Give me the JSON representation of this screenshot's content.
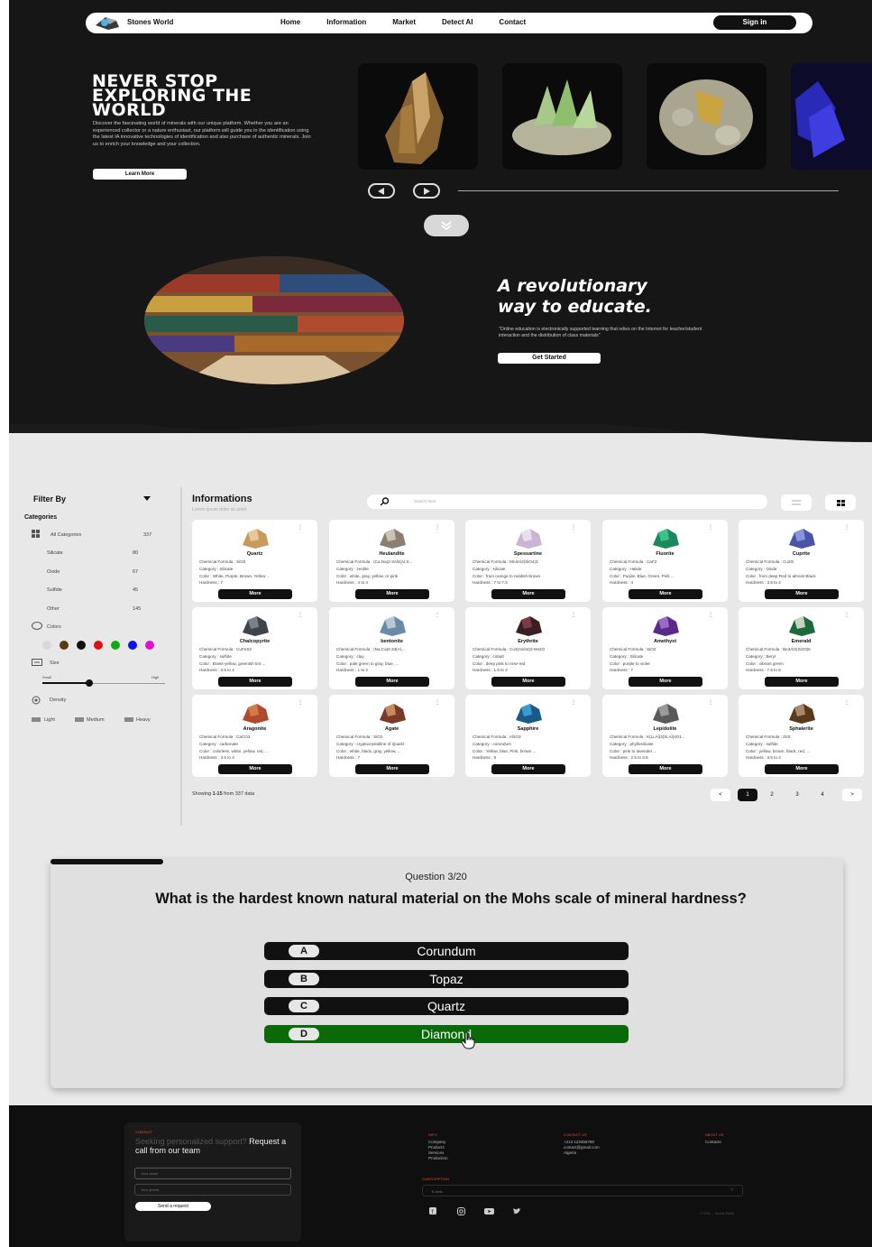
{
  "nav": {
    "brand": "Stones World",
    "items": [
      "Home",
      "Information",
      "Market",
      "Detect AI",
      "Contact"
    ],
    "signin": "Sign in"
  },
  "hero": {
    "title": "NEVER STOP EXPLORING THE WORLD",
    "intro": "Discover the fascinating world of minerals with our unique platform. Whether you are an experienced collector or a nature enthusiast, our platform will guide you in the identification using the latest IA innovative technologies of identification and also purchase of authentic minerals. Join us to enrich your knowledge and your collection.",
    "learn_more": "Learn More"
  },
  "revolution": {
    "title_line1": "A revolutionary",
    "title_line2": "way to educate.",
    "quote": "\"Online education is electronically supported learning that relies on the Internet for teacher/student interaction and the distribution of class materials\"",
    "cta": "Get Started"
  },
  "filters": {
    "title": "Filter By",
    "categories_title": "Categories",
    "categories": [
      {
        "label": "All Categories",
        "count": "337"
      },
      {
        "label": "Silicate",
        "count": "80"
      },
      {
        "label": "Oxide",
        "count": "67"
      },
      {
        "label": "Sulfide",
        "count": "45"
      },
      {
        "label": "Other",
        "count": "145"
      }
    ],
    "colors_title": "Colors",
    "colors": [
      "#d9d9d9",
      "#5a3a12",
      "#111111",
      "#dd1111",
      "#11aa11",
      "#1111ee",
      "#dd11cc"
    ],
    "size_title": "Size",
    "size_low": "Small",
    "size_high": "High",
    "size_level": 0.5,
    "density_title": "Density",
    "density_options": [
      "Light",
      "Medium",
      "Heavy"
    ]
  },
  "info": {
    "title": "Informations",
    "subtitle": "Lorem ipsum dolor sit amet",
    "search_placeholder": "Search here",
    "more_label": "More",
    "cards": [
      {
        "name": "Quartz",
        "formula": "Chemical Formula : SiO2",
        "category": "Category : Silicate",
        "color": "Color : White, Purple, Brown, Yellow ...",
        "hardness": "Hardness : 7"
      },
      {
        "name": "Heulandite",
        "formula": "Chemical Formula : (Ca,Na)2-3Al3(Al,S...",
        "category": "Category : zeolite",
        "color": "Color : white, gray, yellow, or pink",
        "hardness": "Hardness : 4 to 4"
      },
      {
        "name": "Spessartine",
        "formula": "Chemical Formula : Mn3Al2(SiO4)3",
        "category": "Category : silicate",
        "color": "Color : from orange to reddish-brown",
        "hardness": "Hardness : 7 to 7.5"
      },
      {
        "name": "Fluorite",
        "formula": "Chemical Formula : CaF2",
        "category": "Category : Halide",
        "color": "Color : Purple, Blue, Green, Pink ...",
        "hardness": "Hardness : 4"
      },
      {
        "name": "Cuprite",
        "formula": "Chemical Formula : Cu2O",
        "category": "Category : Oxide",
        "color": "Color : from deep Red to almost Black",
        "hardness": "Hardness : 3.5 to 4"
      },
      {
        "name": "Chalcopyrite",
        "formula": "Chemical Formula : CuFeS2",
        "category": "Category : sulfide",
        "color": "Color : Brass-yellow, greenish tint ...",
        "hardness": "Hardness : 3.5 to 4"
      },
      {
        "name": "bentonite",
        "formula": "Chemical Formula : (Na,Ca)0.33(Al,...",
        "category": "Category : clay",
        "color": "Color : pale green to gray, blue, ...",
        "hardness": "Hardness : 1 to 2"
      },
      {
        "name": "Erythrite",
        "formula": "Chemical Formula : Co3(AsO4)2·8H2O",
        "category": "Category : cobalt",
        "color": "Color : deep pink to rose-red",
        "hardness": "Hardness : 1.5 to 2"
      },
      {
        "name": "Amethyst",
        "formula": "Chemical Formula : SiO2",
        "category": "Category : Silicate",
        "color": "Color : purple to violet",
        "hardness": "Hardness : 7"
      },
      {
        "name": "Emerald",
        "formula": "Chemical Formula : Be3Al2(SiO3)6",
        "category": "Category : Beryl",
        "color": "Color : vibrant green",
        "hardness": "Hardness : 7.5 to 8"
      },
      {
        "name": "Aragonite",
        "formula": "Chemical Formula : CaCO3",
        "category": "Category : carbonate",
        "color": "Color : colorless, white, yellow, red, ...",
        "hardness": "Hardness : 3.5 to 4"
      },
      {
        "name": "Agate",
        "formula": "Chemical Formula : SiO2",
        "category": "Category : cryptocrystalline of Quartz",
        "color": "Color : white, black, gray, yellow, ...",
        "hardness": "Hardness : 7"
      },
      {
        "name": "Sapphire",
        "formula": "Chemical Formula : Al2O3",
        "category": "Category : corundum",
        "color": "Color : Yellow, blue, Pink, brown ...",
        "hardness": "Hardness : 9"
      },
      {
        "name": "Lepidolite",
        "formula": "Chemical Formula : K(Li,Al)3(Si,Al)4O1...",
        "category": "Category : phyllosilicate",
        "color": "Color : pink to lavender ...",
        "hardness": "Hardness : 2.5 to 3.5"
      },
      {
        "name": "Sphalerite",
        "formula": "Chemical Formula : ZnS",
        "category": "Category : sulfide",
        "color": "Color : yellow, brown, black, red, ...",
        "hardness": "Hardness : 3.5 to 4"
      }
    ],
    "showing_prefix": "Showing ",
    "showing_range": "1-15",
    "showing_suffix": " from 337 data",
    "pages": [
      "1",
      "2",
      "3",
      "4"
    ],
    "prev": "<",
    "next": ">"
  },
  "quiz": {
    "progress": 0.15,
    "number": "Question 3/20",
    "question": "What is the hardest known natural material on the Mohs scale of mineral hardness?",
    "answers": [
      {
        "letter": "A",
        "text": "Corundum",
        "selected": false
      },
      {
        "letter": "B",
        "text": "Topaz",
        "selected": false
      },
      {
        "letter": "C",
        "text": "Quartz",
        "selected": false
      },
      {
        "letter": "D",
        "text": "Diamond",
        "selected": true
      }
    ]
  },
  "footer": {
    "contact_label": "CONTACT",
    "contact_text_a": "Seeking personalized support?",
    "contact_text_b": " Request a call from our team",
    "name_placeholder": "Your name",
    "phone_placeholder": "Your phone",
    "send": "Send a request",
    "info_title": "INFO",
    "info_items": [
      "Company",
      "Products",
      "Services",
      "Production"
    ],
    "contact_us_title": "CONTACT US",
    "phone": "+213 123456789",
    "email": "contact@gmail.com",
    "city": "Algeria",
    "about_title": "ABOUT US",
    "about_items": [
      "Contacts"
    ],
    "subscription_title": "SUBSCRIPTION",
    "email_placeholder": "E-mail",
    "socials": [
      "facebook-icon",
      "instagram-icon",
      "youtube-icon",
      "twitter-icon"
    ],
    "copyright": "© 2024 — Stones World"
  }
}
